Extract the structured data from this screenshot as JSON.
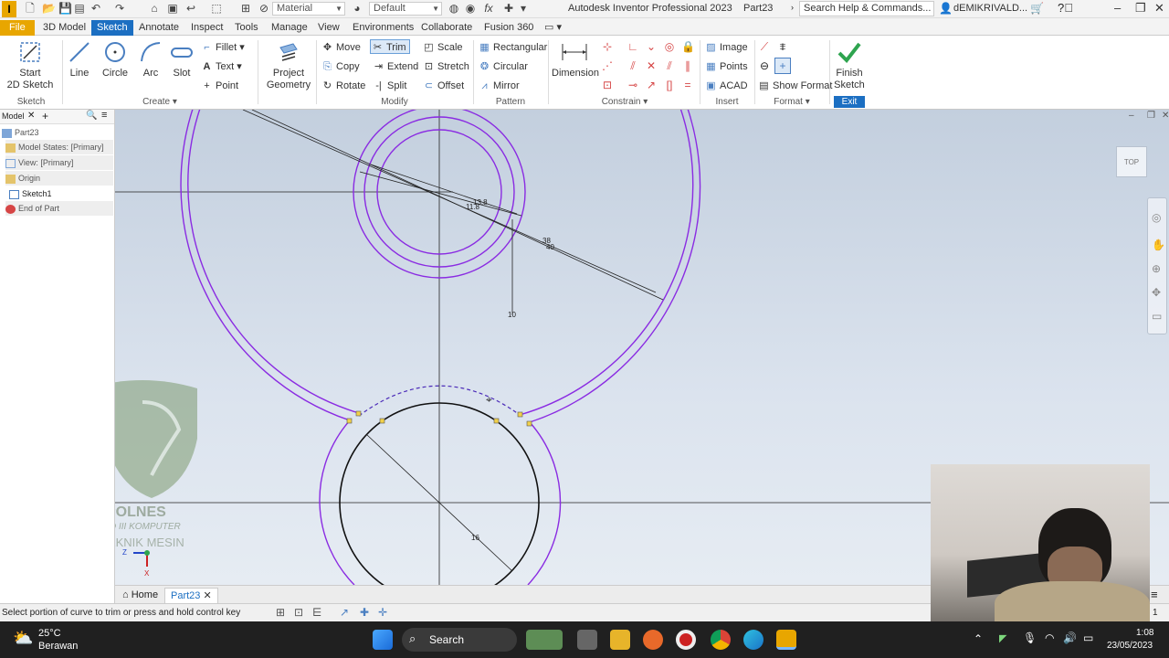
{
  "app": {
    "title": "Autodesk Inventor Professional 2023",
    "document": "Part23",
    "material": "Material",
    "appearance": "Default",
    "search_placeholder": "Search Help & Commands...",
    "user": "dEMIKRIVALD...",
    "logo_letter": "I"
  },
  "tabs": [
    "File",
    "3D Model",
    "Sketch",
    "Annotate",
    "Inspect",
    "Tools",
    "Manage",
    "View",
    "Environments",
    "Collaborate",
    "Fusion 360"
  ],
  "active_tab": "Sketch",
  "ribbon": {
    "sketch_panel": {
      "label": "Sketch",
      "start_line1": "Start",
      "start_line2": "2D Sketch"
    },
    "create_panel": {
      "label": "Create",
      "line": "Line",
      "circle": "Circle",
      "arc": "Arc",
      "slot": "Slot",
      "fillet": "Fillet",
      "text": "Text",
      "point": "Point"
    },
    "project_geometry": {
      "line1": "Project",
      "line2": "Geometry"
    },
    "modify_panel": {
      "label": "Modify",
      "move": "Move",
      "trim": "Trim",
      "scale": "Scale",
      "copy": "Copy",
      "extend": "Extend",
      "stretch": "Stretch",
      "rotate": "Rotate",
      "split": "Split",
      "offset": "Offset"
    },
    "pattern_panel": {
      "label": "Pattern",
      "rectangular": "Rectangular",
      "circular": "Circular",
      "mirror": "Mirror"
    },
    "constrain_panel": {
      "label": "Constrain",
      "dimension": "Dimension"
    },
    "insert_panel": {
      "label": "Insert",
      "image": "Image",
      "points": "Points",
      "acad": "ACAD"
    },
    "format_panel": {
      "label": "Format",
      "show_format": "Show Format"
    },
    "exit_panel": {
      "label": "Exit",
      "finish_line1": "Finish",
      "finish_line2": "Sketch"
    }
  },
  "browser": {
    "tab": "Model",
    "items": [
      "Part23",
      "Model States: [Primary]",
      "View: [Primary]",
      "Origin",
      "Sketch1",
      "End of Part"
    ]
  },
  "sketch": {
    "dimensions": [
      "13.8",
      "11.8",
      "38",
      "40",
      "10",
      "16"
    ],
    "viewcube": "TOP",
    "axis_x": "X",
    "axis_z": "Z"
  },
  "watermark": {
    "line1": "POLNES",
    "line2": "D III KOMPUTER",
    "line3": "TEKNIK MESIN"
  },
  "doc_tabs": {
    "home": "Home",
    "part": "Part23"
  },
  "status": {
    "text": "Select portion of curve to trim or press and hold control key",
    "page": "1"
  },
  "taskbar": {
    "temperature": "25°C",
    "weather": "Berawan",
    "search": "Search",
    "time": "1:08",
    "date": "23/05/2023"
  },
  "colors": {
    "accent": "#1c6fc2",
    "file_tab": "#e8a600",
    "sketch_curve": "#8a2be2",
    "finish_green": "#2ea44f"
  }
}
